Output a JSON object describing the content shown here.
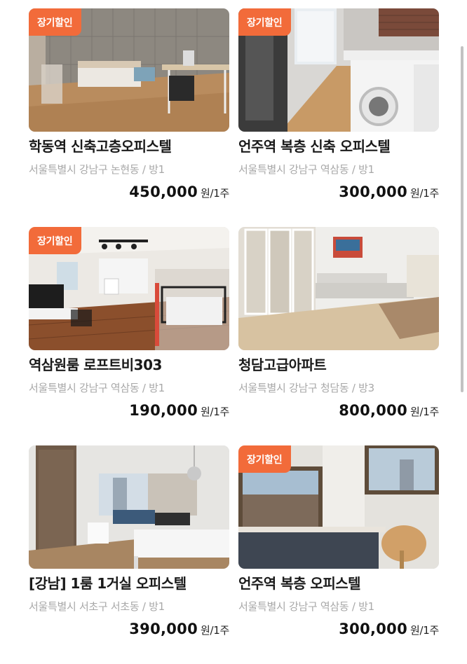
{
  "listings": [
    {
      "badge": "장기할인",
      "title": "학동역 신축고층오피스텔",
      "location": "서울특별시 강남구 논현동 / 방1",
      "price": "450,000",
      "unit": "원/1주"
    },
    {
      "badge": "장기할인",
      "title": "언주역 복층 신축 오피스텔",
      "location": "서울특별시 강남구 역삼동 / 방1",
      "price": "300,000",
      "unit": "원/1주"
    },
    {
      "badge": "장기할인",
      "title": "역삼원룸 로프트비303",
      "location": "서울특별시 강남구 역삼동 / 방1",
      "price": "190,000",
      "unit": "원/1주"
    },
    {
      "title": "청담고급아파트",
      "location": "서울특별시 강남구 청담동 / 방3",
      "price": "800,000",
      "unit": "원/1주"
    },
    {
      "title": "[강남] 1룸 1거실 오피스텔",
      "location": "서울특별시 서초구 서초동 / 방1",
      "price": "390,000",
      "unit": "원/1주"
    },
    {
      "badge": "장기할인",
      "title": "언주역 복층 오피스텔",
      "location": "서울특별시 강남구 역삼동 / 방1",
      "price": "300,000",
      "unit": "원/1주"
    }
  ],
  "colors": {
    "badge": "#f26b3a",
    "title": "#1a1a1a",
    "location": "#a8a8a8",
    "price": "#111111"
  }
}
